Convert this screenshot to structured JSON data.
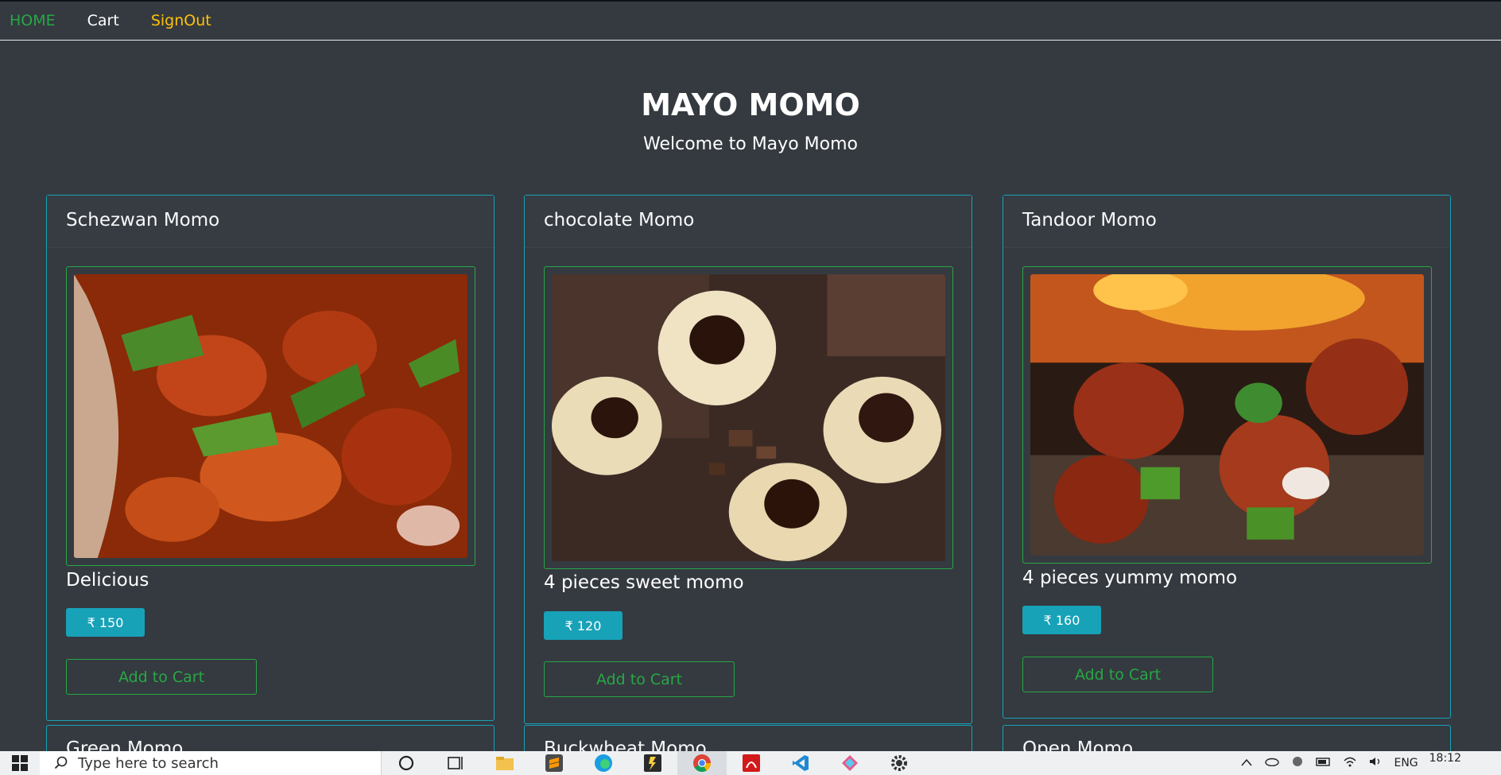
{
  "nav": {
    "home": "HOME",
    "cart": "Cart",
    "signout": "SignOut"
  },
  "hero": {
    "title": "MAYO MOMO",
    "subtitle": "Welcome to Mayo Momo"
  },
  "products": [
    {
      "name": "Schezwan Momo",
      "description": "Delicious",
      "price": "₹ 150",
      "button": "Add to Cart"
    },
    {
      "name": "chocolate Momo",
      "description": "4 pieces sweet momo",
      "price": "₹ 120",
      "button": "Add to Cart"
    },
    {
      "name": "Tandoor Momo",
      "description": "4 pieces yummy momo",
      "price": "₹ 160",
      "button": "Add to Cart"
    }
  ],
  "next_row": [
    "Green Momo",
    "Buckwheat Momo",
    "Open Momo"
  ],
  "taskbar": {
    "search_placeholder": "Type here to search",
    "language": "ENG",
    "time": "18:12",
    "pinned_icons": [
      "cortana-icon",
      "task-view-icon",
      "file-explorer-icon",
      "sublime-icon",
      "edge-icon",
      "sticky-notes-icon",
      "chrome-icon",
      "acrobat-icon",
      "vscode-icon",
      "app-icon",
      "settings-icon"
    ]
  },
  "colors": {
    "page_bg": "#343a40",
    "accent_info": "#17a2b8",
    "accent_success": "#28a745",
    "accent_warning": "#ffc107"
  }
}
